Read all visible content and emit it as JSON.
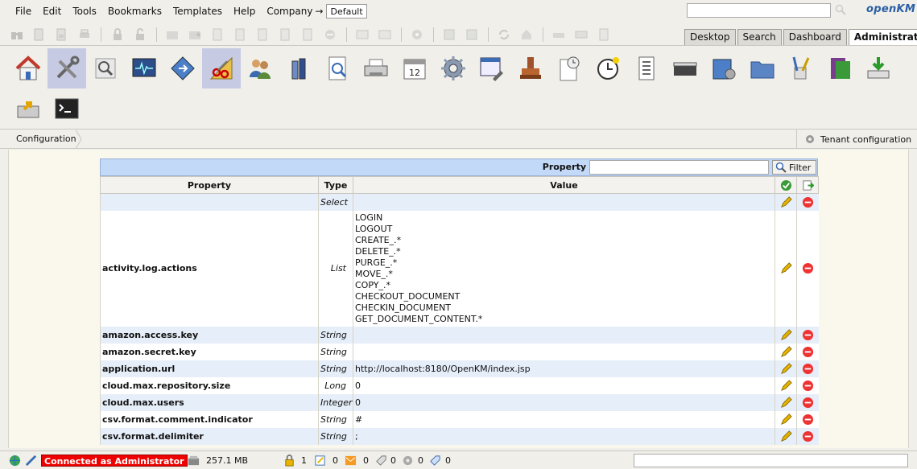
{
  "menu": {
    "items": [
      "File",
      "Edit",
      "Tools",
      "Bookmarks",
      "Templates",
      "Help"
    ],
    "company_label": "Company",
    "arrow": "→",
    "company_value": "Default"
  },
  "logo": "openKM",
  "tabs": [
    {
      "label": "Desktop",
      "active": false
    },
    {
      "label": "Search",
      "active": false
    },
    {
      "label": "Dashboard",
      "active": false
    },
    {
      "label": "Administration",
      "active": true
    }
  ],
  "admin_icons": [
    "home-icon",
    "tools-icon",
    "search-config-icon",
    "monitor-icon",
    "diamond-icon",
    "scissors-ruler-icon",
    "users-icon",
    "bottles-icon",
    "document-search-icon",
    "printer-icon",
    "calendar-icon",
    "gear-icon",
    "window-edit-icon",
    "stamp-icon",
    "clock-document-icon",
    "clock-icon",
    "list-icon",
    "scanner-icon",
    "disk-gear-icon",
    "folder-icon",
    "brush-cup-icon",
    "book-icon",
    "download-icon",
    "folder-arrow-icon",
    "terminal-icon"
  ],
  "admin_selected": [
    "tools-icon",
    "scissors-ruler-icon"
  ],
  "calendar_day": "12",
  "breadcrumb": "Configuration",
  "tenant_config": "Tenant configuration",
  "filter": {
    "label": "Property",
    "value": "",
    "button": "Filter"
  },
  "grid": {
    "headers": {
      "property": "Property",
      "type": "Type",
      "value": "Value"
    },
    "new_row_type": "Select",
    "rows": [
      {
        "property": "activity.log.actions",
        "type": "List",
        "values": [
          "LOGIN",
          "LOGOUT",
          "CREATE_.*",
          "DELETE_.*",
          "PURGE_.*",
          "MOVE_.*",
          "COPY_.*",
          "CHECKOUT_DOCUMENT",
          "CHECKIN_DOCUMENT",
          "GET_DOCUMENT_CONTENT.*"
        ]
      },
      {
        "property": "amazon.access.key",
        "type": "String",
        "value": ""
      },
      {
        "property": "amazon.secret.key",
        "type": "String",
        "value": ""
      },
      {
        "property": "application.url",
        "type": "String",
        "value": "http://localhost:8180/OpenKM/index.jsp"
      },
      {
        "property": "cloud.max.repository.size",
        "type": "Long",
        "value": "0"
      },
      {
        "property": "cloud.max.users",
        "type": "Integer",
        "value": "0"
      },
      {
        "property": "csv.format.comment.indicator",
        "type": "String",
        "value": "#"
      },
      {
        "property": "csv.format.delimiter",
        "type": "String",
        "value": ";"
      }
    ]
  },
  "status": {
    "connected": "Connected as Administrator",
    "repo_size": "257.1 MB",
    "counters": [
      {
        "icon": "lock-icon",
        "value": "1"
      },
      {
        "icon": "edit-doc-icon",
        "value": "0"
      },
      {
        "icon": "mail-icon",
        "value": "0"
      },
      {
        "icon": "tag-icon",
        "value": "0"
      },
      {
        "icon": "gear-icon",
        "value": "0"
      },
      {
        "icon": "label-icon",
        "value": "0"
      }
    ],
    "search_value": ""
  },
  "colors": {
    "selected_icon_bg": "#c6cbe3",
    "filter_bar": "#c3d9f8",
    "row_alt": "#e6eef9",
    "connected_bg": "#ee0000",
    "logo": "#2a5fa6"
  }
}
